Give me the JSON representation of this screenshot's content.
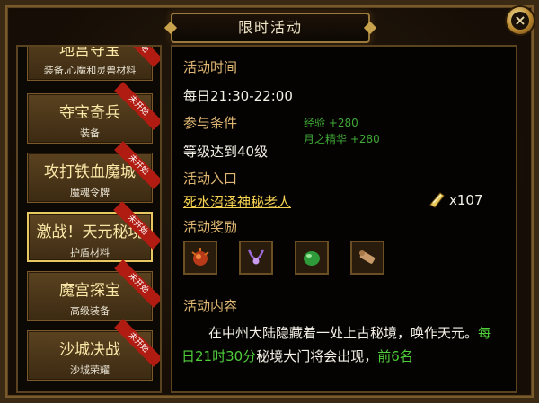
{
  "title": "限时活动",
  "close_icon": "×",
  "activities": [
    {
      "name": "地宫夺宝",
      "sub": "装备,心魔和灵兽材料",
      "badge": "未开始"
    },
    {
      "name": "夺宝奇兵",
      "sub": "装备",
      "badge": "未开始"
    },
    {
      "name": "攻打铁血魔城",
      "sub": "魔魂令牌",
      "badge": "未开始"
    },
    {
      "name": "激战！天元秘境",
      "sub": "护盾材料",
      "badge": "未开始"
    },
    {
      "name": "魔宫探宝",
      "sub": "高级装备",
      "badge": "未开始"
    },
    {
      "name": "沙城决战",
      "sub": "沙城荣耀",
      "badge": "未开始"
    }
  ],
  "detail": {
    "time_header": "活动时间",
    "time_value": "每日21:30-22:00",
    "cond_header": "参与条件",
    "cond_value": "等级达到40级",
    "bonus_exp": "经验 +280",
    "bonus_moon": "月之精华 +280",
    "entry_header": "活动入口",
    "entry_link": "死水沼泽神秘老人",
    "item_count": "x107",
    "reward_header": "活动奖励",
    "rewards": [
      "red-orb-reward-icon",
      "purple-necklace-reward-icon",
      "green-gem-reward-icon",
      "scroll-reward-icon"
    ],
    "content_header": "活动内容",
    "content_p1": "在中州大陆隐藏着一处上古秘境，唤作天元。",
    "content_green1": "每日21时30分",
    "content_p2": "秘境大门将会出现，",
    "content_green2": "前6名"
  }
}
